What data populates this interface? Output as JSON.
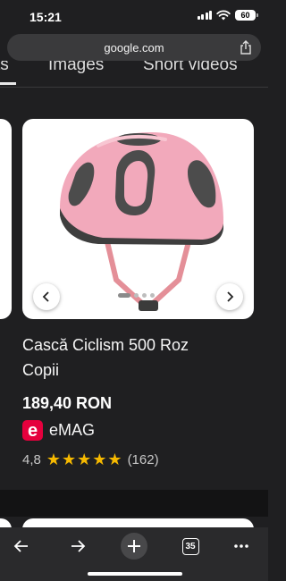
{
  "status_bar": {
    "time": "15:21",
    "battery": "60"
  },
  "browser": {
    "url": "google.com",
    "tab_count": "35"
  },
  "tabs": [
    "ts",
    "Images",
    "Short videos"
  ],
  "product": {
    "title_line1": "Cască Ciclism 500 Roz",
    "title_line2": "Copii",
    "price": "189,40 RON",
    "seller": "eMAG",
    "seller_logo_letter": "e",
    "rating": "4,8",
    "reviews": "(162)",
    "stars": 5
  },
  "colors": {
    "accent_star": "#f6b900",
    "emag": "#e5003d",
    "helmet_pink": "#f2a9bb"
  },
  "icons": [
    "back-icon",
    "forward-icon",
    "new-tab-icon",
    "tab-switcher-icon",
    "more-icon",
    "share-icon",
    "chevron-left-icon",
    "chevron-right-icon"
  ]
}
